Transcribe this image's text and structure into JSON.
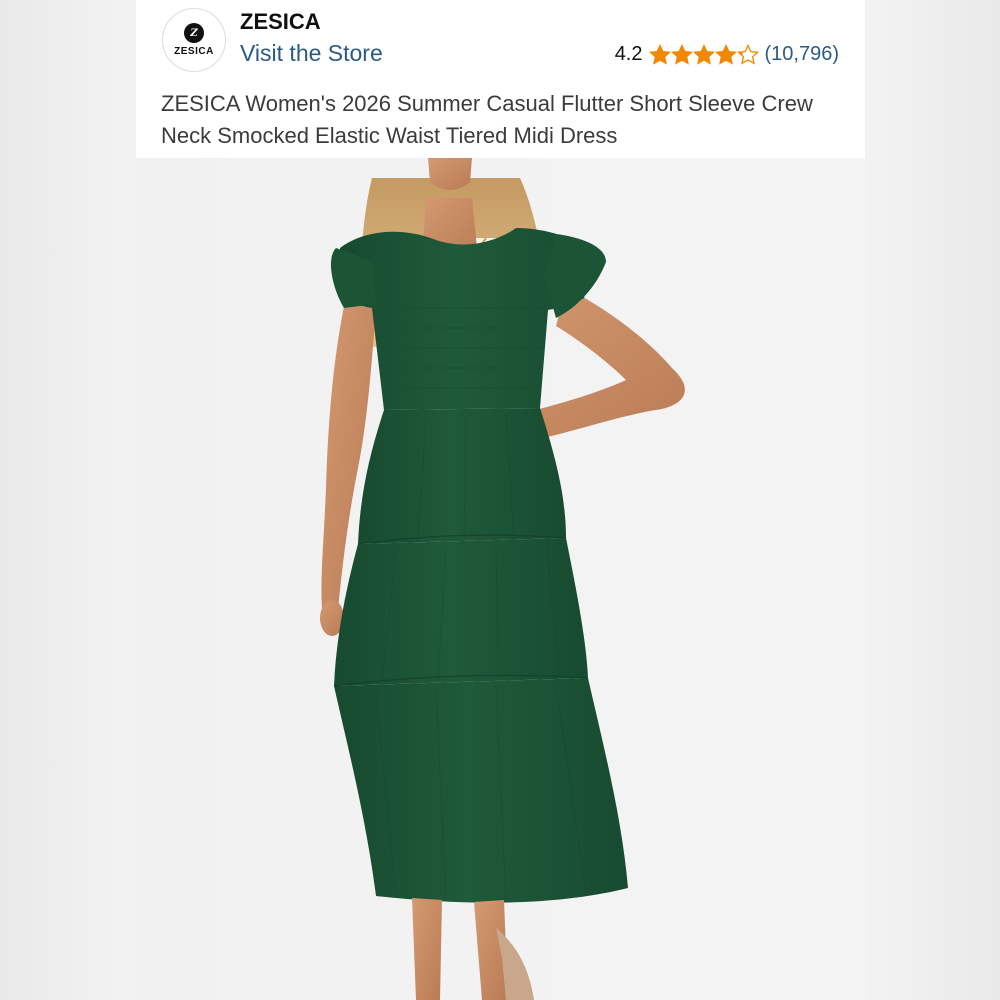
{
  "store": {
    "logo_text": "ZESICA",
    "logo_monogram": "Z",
    "brand_name": "ZESICA",
    "visit_label": "Visit the Store"
  },
  "rating": {
    "value": "4.2",
    "stars_filled": 4.2,
    "stars_total": 5,
    "count": "(10,796)",
    "star_color": "#f08804",
    "icon": "star-icon"
  },
  "product": {
    "title": "ZESICA Women's 2026 Summer Casual Flutter Short Sleeve Crew Neck Smocked Elastic Waist Tiered Midi Dress",
    "image": "product-photo",
    "dress_color": "#1f5a3a"
  },
  "colors": {
    "link": "#2b5b84",
    "text": "#3b3b3b"
  }
}
